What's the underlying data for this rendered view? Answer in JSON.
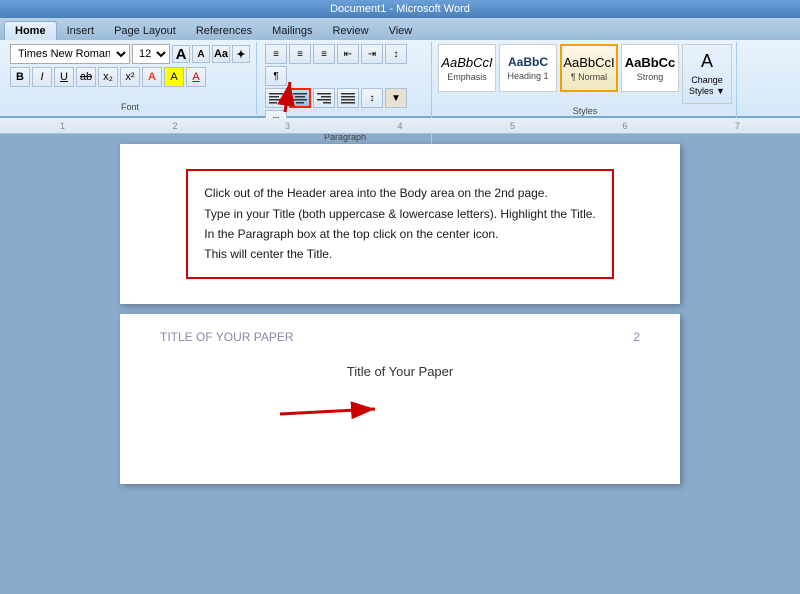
{
  "titlebar": {
    "text": "Document1 - Microsoft Word"
  },
  "tabs": [
    {
      "label": "Home",
      "active": true
    },
    {
      "label": "Insert",
      "active": false
    },
    {
      "label": "Page Layout",
      "active": false
    },
    {
      "label": "References",
      "active": false
    },
    {
      "label": "Mailings",
      "active": false
    },
    {
      "label": "Review",
      "active": false
    },
    {
      "label": "View",
      "active": false
    }
  ],
  "font_group": {
    "label": "Font",
    "font_name": "Times New Roman",
    "font_size": "12",
    "bold": "B",
    "italic": "I",
    "underline": "U",
    "strikethrough": "ab",
    "subscript": "x₂",
    "superscript": "x²",
    "grow": "A",
    "shrink": "A",
    "clear": "Aa",
    "highlight": "A"
  },
  "paragraph_group": {
    "label": "Paragraph",
    "btn_bullets": "≡",
    "btn_numbering": "≡",
    "btn_outdent": "←",
    "btn_indent": "→",
    "btn_sort": "↕",
    "btn_show": "¶",
    "btn_align_left": "≡",
    "btn_align_center": "≡",
    "btn_align_right": "≡",
    "btn_justify": "≡",
    "btn_lspacing": "↕",
    "btn_shading": "▲",
    "btn_borders": "□"
  },
  "styles_group": {
    "label": "Styles",
    "emphasis_label": "Emphasis",
    "emphasis_preview": "AaBbCcI",
    "heading1_label": "Heading 1",
    "heading1_preview": "AaBbC",
    "normal_label": "¶ Normal",
    "normal_preview": "AaBbCcI",
    "strong_label": "Strong",
    "strong_preview": "AaBbCc",
    "change_styles_label": "Change\nStyles",
    "change_styles_symbol": "="
  },
  "document": {
    "instruction_lines": [
      "Click out of the Header area into the Body area on the 2nd page.",
      "Type in your Title (both uppercase & lowercase letters). Highlight the Title.",
      "In the Paragraph box at the top click on the center icon.",
      "This will center the Title."
    ],
    "page2_header_left": "TITLE OF YOUR PAPER",
    "page2_header_right": "2",
    "page2_title": "Title of Your Paper"
  }
}
